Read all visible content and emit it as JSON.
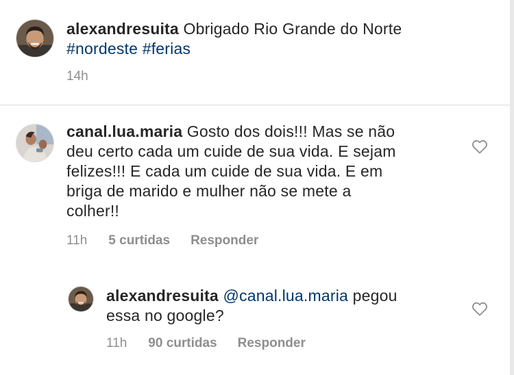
{
  "caption": {
    "username": "alexandresuita",
    "text": "Obrigado Rio Grande do Norte",
    "hashtags": [
      "#nordeste",
      "#ferias"
    ],
    "time": "14h"
  },
  "comment": {
    "username": "canal.lua.maria",
    "text_line1": "Gosto dos dois!!! Mas se não",
    "text_line2": "deu certo  cada um cuide de sua vida. E sejam",
    "text_line3": "felizes!!! E cada um cuide de sua  vida.  E em",
    "text_line4": "briga de marido e mulher não se mete a",
    "text_line5": "colher!!",
    "time": "11h",
    "likes": "5 curtidas",
    "reply_label": "Responder",
    "like_icon": "heart-outline-icon"
  },
  "reply": {
    "username": "alexandresuita",
    "mention": "@canal.lua.maria",
    "text_line1": "pegou",
    "text_line2": "essa no google?",
    "time": "11h",
    "likes": "90 curtidas",
    "reply_label": "Responder",
    "like_icon": "heart-outline-icon"
  },
  "colors": {
    "text": "#262626",
    "link": "#00376b",
    "muted": "#8e8e8e",
    "divider": "#dbdbdb"
  }
}
